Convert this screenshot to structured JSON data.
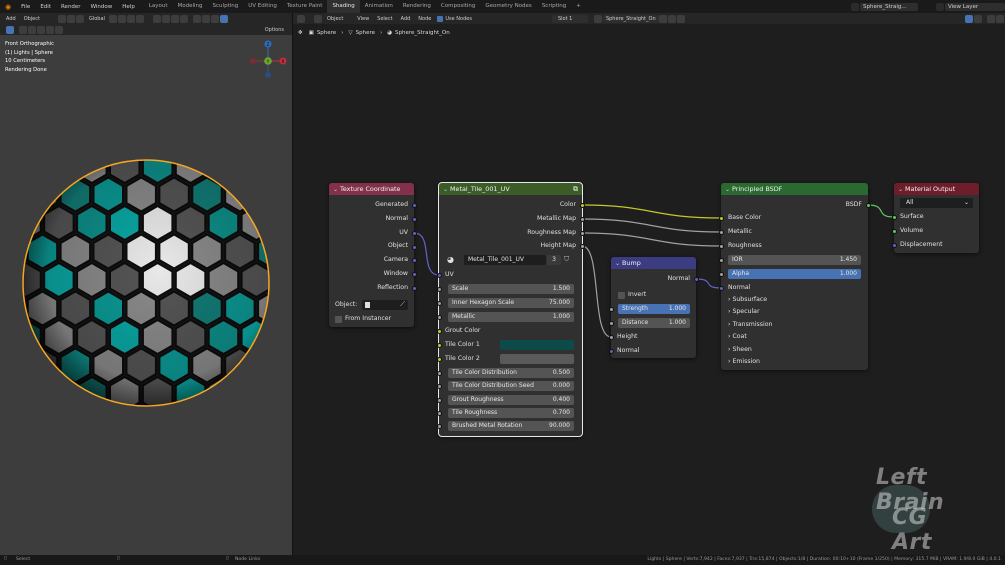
{
  "menu": {
    "items": [
      "File",
      "Edit",
      "Render",
      "Window",
      "Help"
    ],
    "workspaces": [
      "Layout",
      "Modeling",
      "Sculpting",
      "UV Editing",
      "Texture Paint",
      "Shading",
      "Animation",
      "Rendering",
      "Compositing",
      "Geometry Nodes",
      "Scripting"
    ],
    "active_workspace": "Shading",
    "add_tab": "+",
    "scene_name": "Sphere_Straig...",
    "view_layer": "View Layer"
  },
  "viewport": {
    "header_left": "Add",
    "mode": "Object",
    "transform": "Global",
    "options": "Options",
    "overlay_lines": [
      "Front Orthographic",
      "(1) Lights | Sphere",
      "10 Centimeters",
      "Rendering Done"
    ],
    "gizmo": {
      "z": "Z",
      "y": "Y",
      "x": "X"
    }
  },
  "node_editor": {
    "header": {
      "mode": "Object",
      "menus": [
        "View",
        "Select",
        "Add",
        "Node"
      ],
      "use_nodes": "Use Nodes",
      "slot": "Slot 1",
      "material": "Sphere_Straight_On"
    },
    "breadcrumb": [
      "Sphere",
      "Sphere",
      "Sphere_Straight_On"
    ]
  },
  "nodes": {
    "texcoord": {
      "title": "Texture Coordinate",
      "outputs": [
        "Generated",
        "Normal",
        "UV",
        "Object",
        "Camera",
        "Window",
        "Reflection"
      ],
      "object_label": "Object:",
      "from_instancer": "From Instancer"
    },
    "group": {
      "title": "Metal_Tile_001_UV",
      "outputs": [
        "Color",
        "Metallic Map",
        "Roughness Map",
        "Height Map"
      ],
      "datablock": "Metal_Tile_001_UV",
      "users": "3",
      "uv_label": "UV",
      "fields": [
        {
          "label": "Scale",
          "value": "1.500"
        },
        {
          "label": "Inner Hexagon Scale",
          "value": "75.000"
        },
        {
          "label": "Metallic",
          "value": "1.000"
        }
      ],
      "grout_color": "Grout Color",
      "tile_color_1": "Tile Color 1",
      "tile_color_2": "Tile Color 2",
      "fields2": [
        {
          "label": "Tile Color Distribution",
          "value": "0.500"
        },
        {
          "label": "Tile Color Distribution Seed",
          "value": "0.000"
        },
        {
          "label": "Grout Roughness",
          "value": "0.400"
        },
        {
          "label": "Tile Roughness",
          "value": "0.700"
        },
        {
          "label": "Brushed Metal Rotation",
          "value": "90.000"
        }
      ],
      "colors": {
        "tile1": "#0d4b4b",
        "tile2": "#5a5a5a"
      }
    },
    "bump": {
      "title": "Bump",
      "output": "Normal",
      "invert": "Invert",
      "strength_label": "Strength",
      "strength": "1.000",
      "distance_label": "Distance",
      "distance": "1.000",
      "inputs": [
        "Height",
        "Normal"
      ]
    },
    "bsdf": {
      "title": "Principled BSDF",
      "output": "BSDF",
      "inputs": [
        "Base Color",
        "Metallic",
        "Roughness"
      ],
      "ior_label": "IOR",
      "ior": "1.450",
      "alpha_label": "Alpha",
      "alpha": "1.000",
      "normal": "Normal",
      "panels": [
        "Subsurface",
        "Specular",
        "Transmission",
        "Coat",
        "Sheen",
        "Emission"
      ]
    },
    "output": {
      "title": "Material Output",
      "target": "All",
      "inputs": [
        "Surface",
        "Volume",
        "Displacement"
      ]
    }
  },
  "watermark": {
    "line1": "Left Brain",
    "line2": "CG Art"
  },
  "status": {
    "left": "Select",
    "mid": "Node Links",
    "right": "Lights | Sphere | Verts:7,942 | Faces:7,937 | Tris:15,874 | Objects:1/8 | Duration: 00:10+10 (Frame 1/250) | Memory: 315.7 MiB | VRAM: 1.9/8.0 GiB | 4.0.1"
  },
  "colors": {
    "accent": "#4772b3",
    "socket_yellow": "#c7c729",
    "socket_gray": "#a1a1a1",
    "socket_purple": "#6363c7",
    "socket_green": "#63c763",
    "hdr_input": "#83314a",
    "hdr_group": "#3b5c27",
    "hdr_vector": "#3c3c83",
    "hdr_shader": "#2a6a30",
    "hdr_output": "#6e1d2b",
    "sphere_outline": "#f5a623"
  }
}
